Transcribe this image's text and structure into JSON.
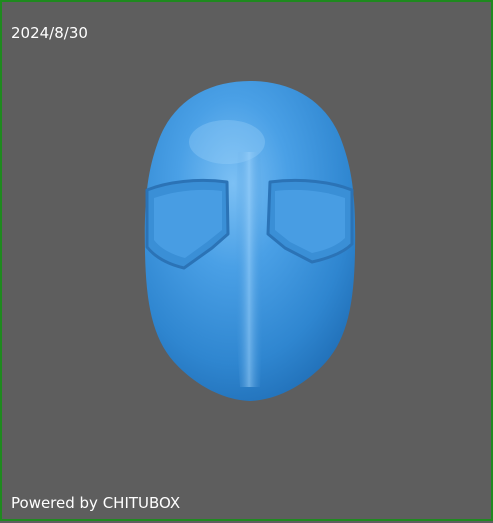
{
  "viewer": {
    "date": "2024/8/30",
    "powered_by": "Powered by CHITUBOX",
    "model_icon": "helmet-mask-icon",
    "colors": {
      "background": "#5e5e5e",
      "border": "#1f8a1f",
      "model": "#3f95d9",
      "text": "#ffffff"
    }
  }
}
